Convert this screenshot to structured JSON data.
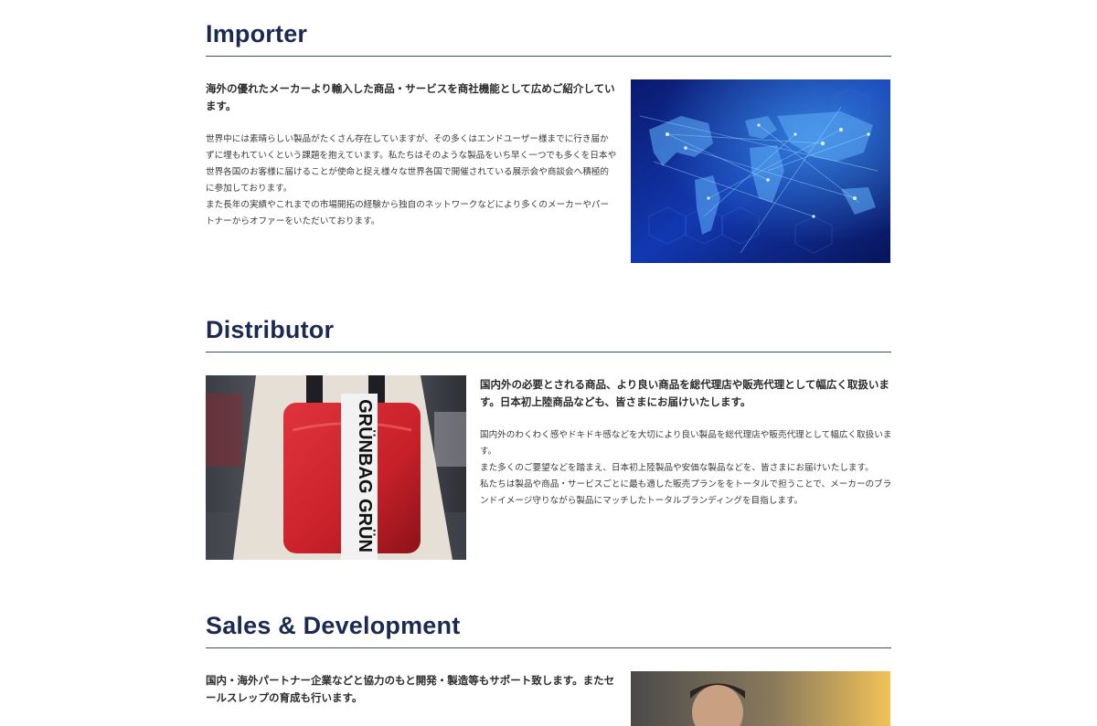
{
  "sections": {
    "importer": {
      "title": "Importer",
      "lead": "海外の優れたメーカーより輸入した商品・サービスを商社機能として広めご紹介しています。",
      "body": [
        "世界中には素晴らしい製品がたくさん存在していますが、その多くはエンドユーザー様までに行き届かずに埋もれていくという課題を抱えています。私たちはそのような製品をいち早く一つでも多くを日本や世界各国のお客様に届けることが使命と捉え様々な世界各国で開催されている展示会や商談会へ積極的に参加しております。",
        "また長年の実績やこれまでの市場開拓の経験から独自のネットワークなどにより多くのメーカーやパートナーからオファーをいただいております。"
      ],
      "image_alt": "world-network-map"
    },
    "distributor": {
      "title": "Distributor",
      "lead": "国内外の必要とされる商品、より良い商品を総代理店や販売代理として幅広く取扱います。日本初上陸商品なども、皆さまにお届けいたします。",
      "body": [
        "国内外のわくわく感やドキドキ感などを大切により良い製品を総代理店や販売代理として幅広く取扱います。",
        "また多くのご要望などを踏まえ、日本初上陸製品や安価な製品などを、皆さまにお届けいたします。",
        "私たちは製品や商品・サービスごとに最も適した販売プランををトータルで担うことで、メーカーのブランドイメージ守りながら製品にマッチしたトータルブランディングを目指します。"
      ],
      "image_text": "GRÜNBAG GRÜN"
    },
    "sales": {
      "title": "Sales & Development",
      "lead": "国内・海外パートナー企業などと協力のもと開発・製造等もサポート致します。またセールスレップの育成も行います。"
    }
  },
  "colors": {
    "heading": "#1c2a52",
    "rule": "#3f4a6d",
    "text": "#333333",
    "bag_red": "#c8202a"
  }
}
